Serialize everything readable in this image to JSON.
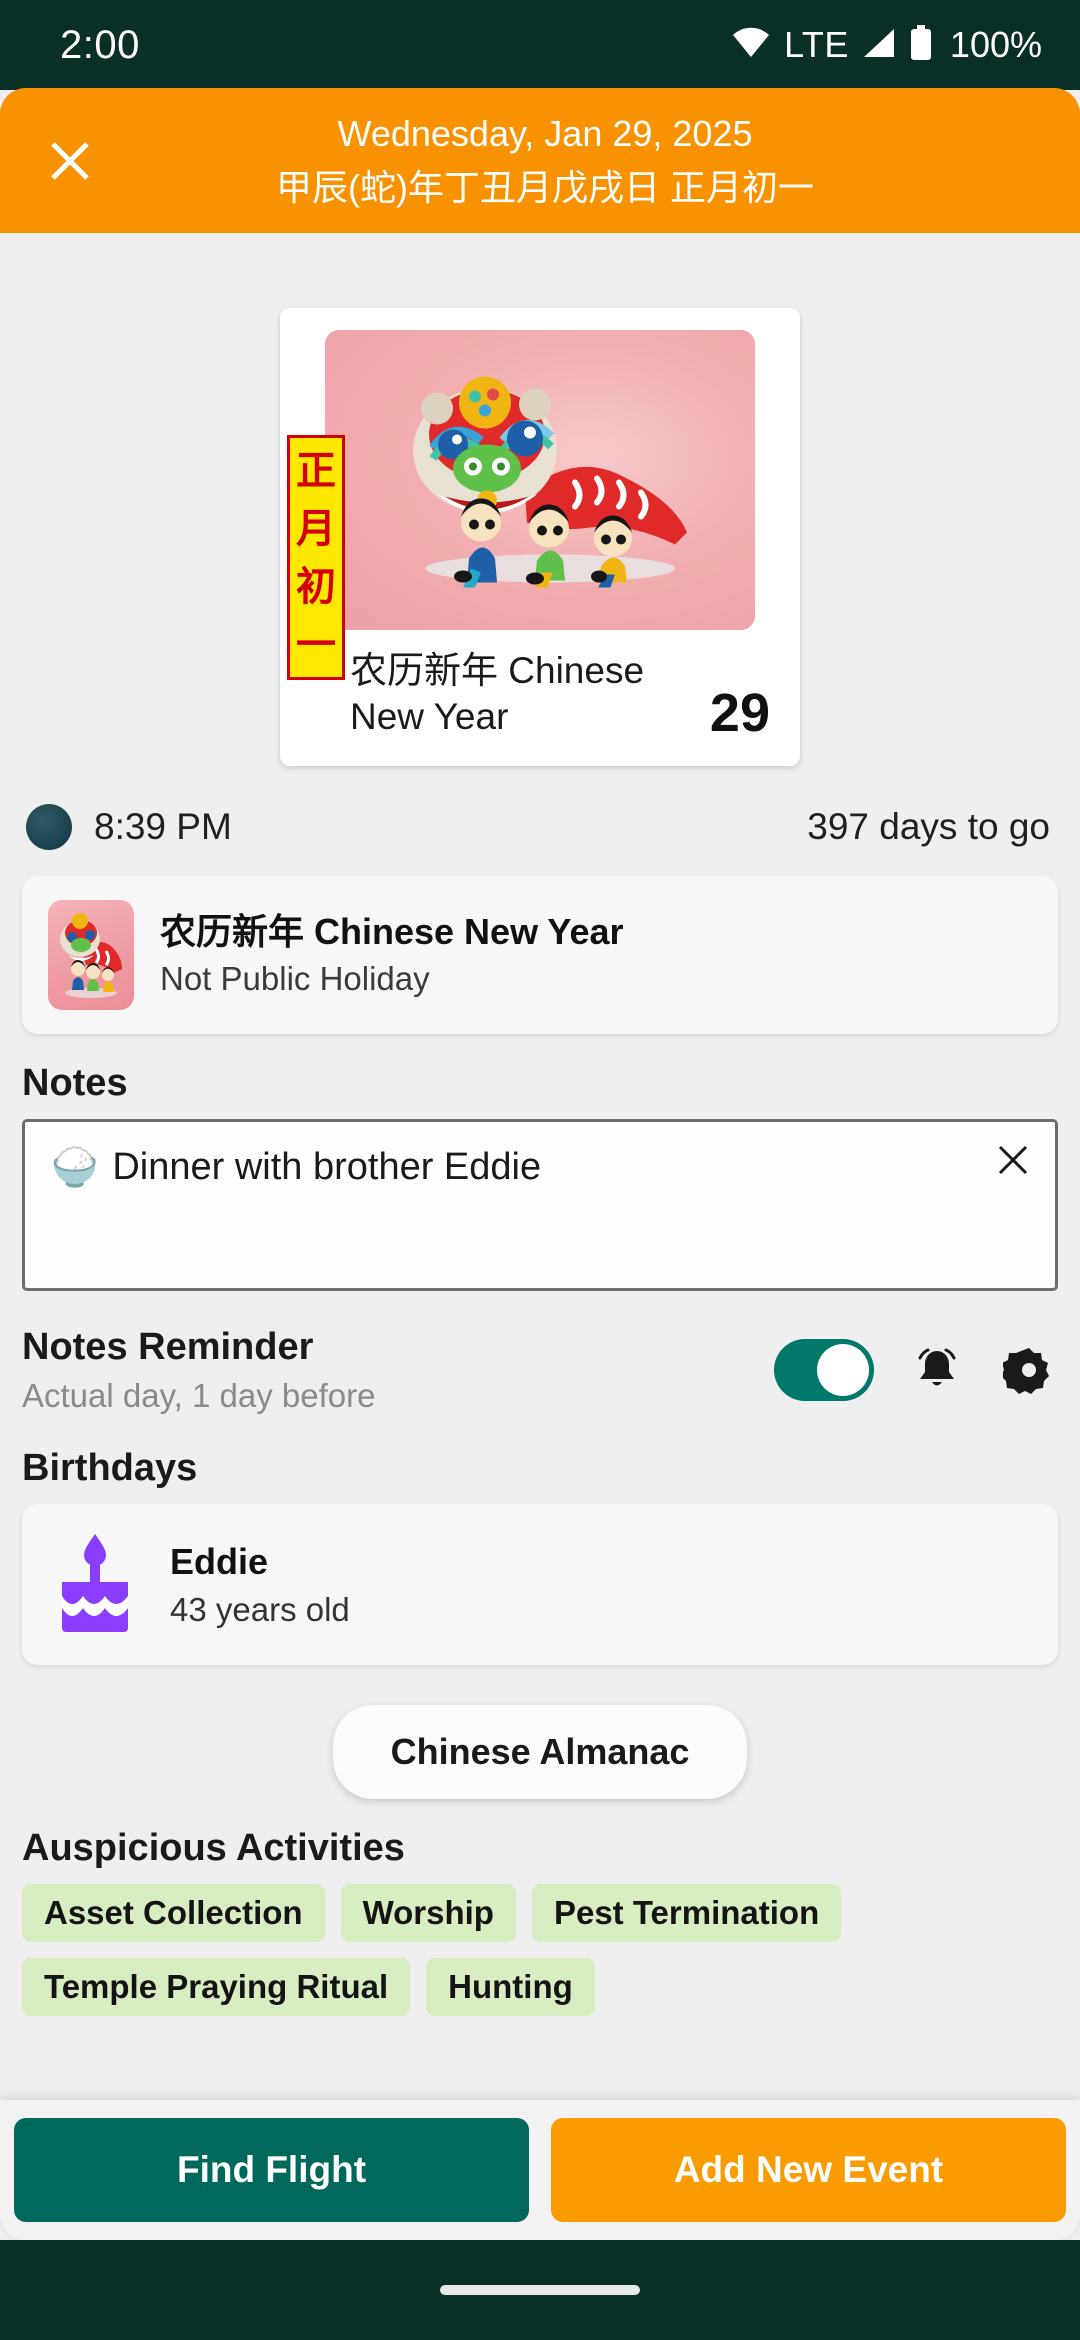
{
  "statusbar": {
    "time": "2:00",
    "network": "LTE",
    "battery": "100%",
    "icons": [
      "wifi-icon",
      "signal-icon",
      "battery-icon"
    ]
  },
  "header": {
    "close_label": "×",
    "date": "Wednesday, Jan 29, 2025",
    "lunar": "甲辰(蛇)年丁丑月戊戌日 正月初一",
    "bg_color": "#f99200"
  },
  "event_card": {
    "lunar_tag": [
      "正",
      "月",
      "初",
      "一"
    ],
    "title": "农历新年 Chinese New Year",
    "day_number": "29"
  },
  "time_row": {
    "moon_icon": "new-moon-icon",
    "time": "8:39 PM",
    "days_to_go": "397 days to go"
  },
  "holiday": {
    "name": "农历新年 Chinese New Year",
    "status": "Not Public Holiday"
  },
  "notes": {
    "title": "Notes",
    "emoji": "🍚",
    "text": "Dinner with brother Eddie",
    "clear_label": "✕",
    "placeholder": "Notes"
  },
  "reminder": {
    "title": "Notes Reminder",
    "subtitle": "Actual day, 1 day before",
    "toggle_on": true,
    "toggle_color": "#00786a",
    "bell_icon": "bell-ringing-icon",
    "gear_icon": "gear-icon"
  },
  "birthdays": {
    "title": "Birthdays",
    "items": [
      {
        "name": "Eddie",
        "age": "43 years old",
        "icon": "birthday-cake-icon",
        "color": "#8B3DFF"
      }
    ]
  },
  "almanac": {
    "label": "Chinese Almanac"
  },
  "auspicious": {
    "title": "Auspicious Activities",
    "chips": [
      "Asset Collection",
      "Worship",
      "Pest Termination",
      "Temple Praying Ritual",
      "Hunting"
    ],
    "chip_color": "#d9edc2"
  },
  "bottom_actions": {
    "find_flight": "Find Flight",
    "add_new_event": "Add New Event",
    "find_flight_color": "#00695c",
    "add_event_color": "#fb9b02"
  }
}
